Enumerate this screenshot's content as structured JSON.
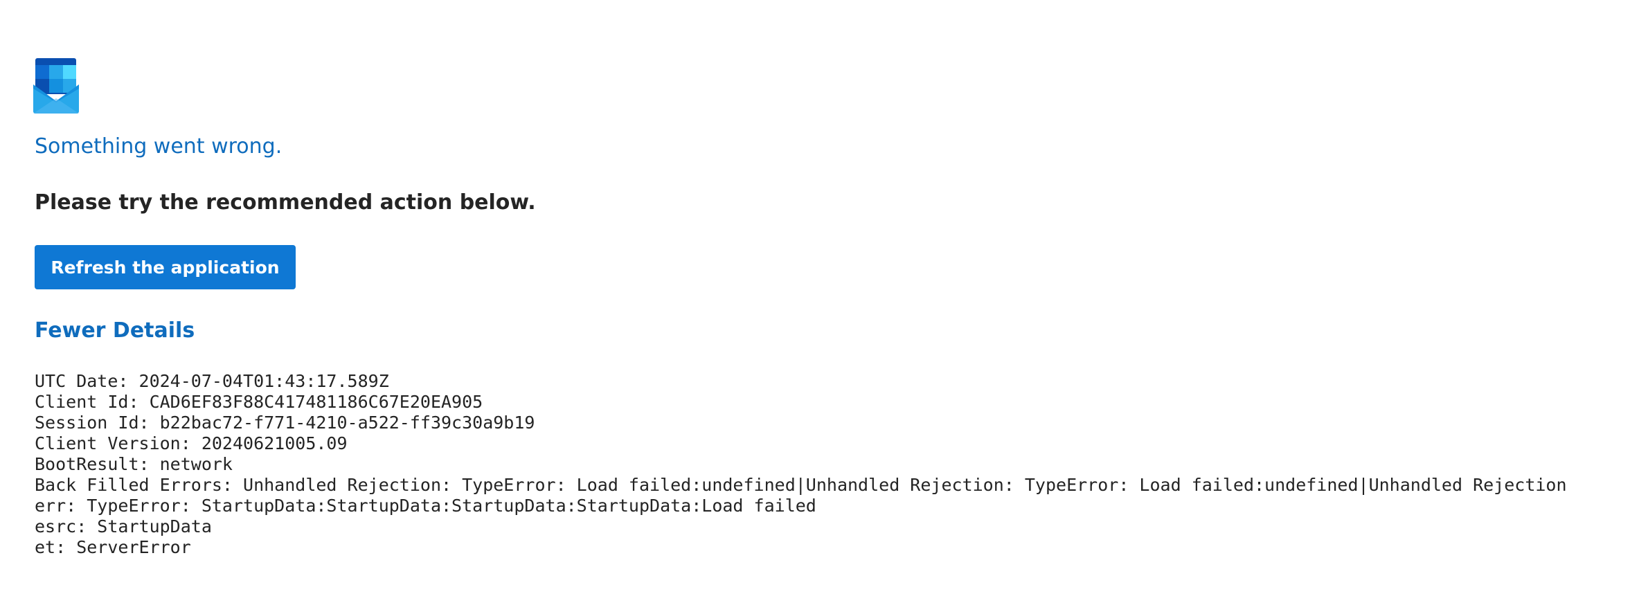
{
  "error": {
    "title": "Something went wrong.",
    "subtitle": "Please try the recommended action below."
  },
  "actions": {
    "refresh_label": "Refresh the application",
    "details_toggle_label": "Fewer Details"
  },
  "details": {
    "lines": [
      "UTC Date: 2024-07-04T01:43:17.589Z",
      "Client Id: CAD6EF83F88C417481186C67E20EA905",
      "Session Id: b22bac72-f771-4210-a522-ff39c30a9b19",
      "Client Version: 20240621005.09",
      "BootResult: network",
      "Back Filled Errors: Unhandled Rejection: TypeError: Load failed:undefined|Unhandled Rejection: TypeError: Load failed:undefined|Unhandled Rejection",
      "err: TypeError: StartupData:StartupData:StartupData:StartupData:Load failed",
      "esrc: StartupData",
      "et: ServerError"
    ]
  },
  "icons": {
    "logo": "outlook-envelope-icon"
  },
  "colors": {
    "link": "#0f6cbd",
    "button": "#0f78d4",
    "text": "#242424",
    "background": "#ffffff"
  }
}
